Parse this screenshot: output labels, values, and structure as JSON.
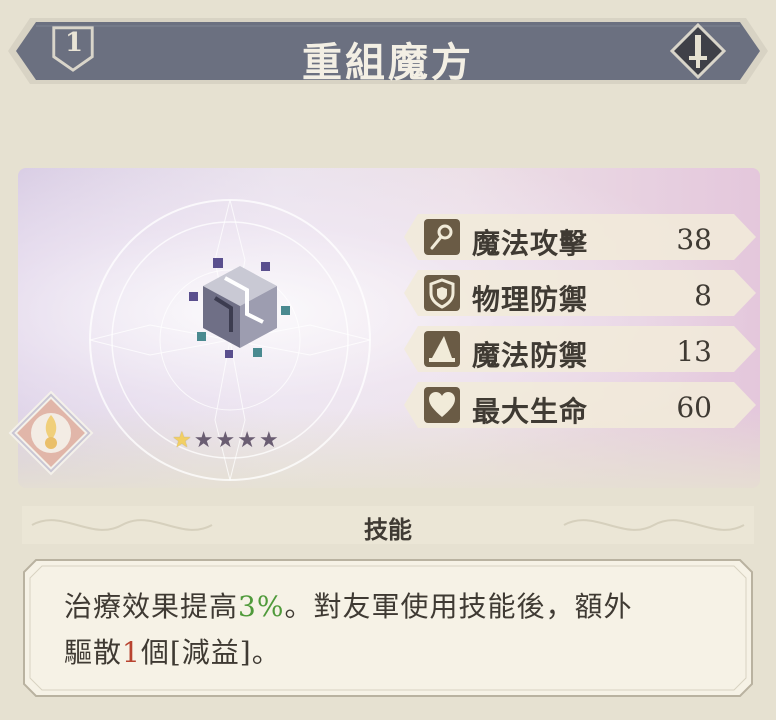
{
  "header": {
    "level": "1",
    "title": "重組魔方",
    "type_icon": "sword-icon"
  },
  "rating": {
    "stars_filled": 1,
    "stars_total": 5
  },
  "stats": [
    {
      "icon": "wand-icon",
      "label": "魔法攻擊",
      "value": "38"
    },
    {
      "icon": "shield-icon",
      "label": "物理防禦",
      "value": "8"
    },
    {
      "icon": "wizard-hat-icon",
      "label": "魔法防禦",
      "value": "13"
    },
    {
      "icon": "heart-icon",
      "label": "最大生命",
      "value": "60"
    }
  ],
  "skill": {
    "header": "技能",
    "line1_a": "治療效果提高",
    "line1_pct": "3%",
    "line1_b": "。對友軍使用技能後，額外",
    "line2_a": "驅散",
    "line2_num": "1",
    "line2_b": "個[減益]。"
  },
  "colors": {
    "banner": "#6b7080",
    "stat_bar": "#f1ebd9",
    "icon_bg": "#6a5b45",
    "highlight_green": "#4f9a3a",
    "highlight_red": "#b8432f"
  }
}
